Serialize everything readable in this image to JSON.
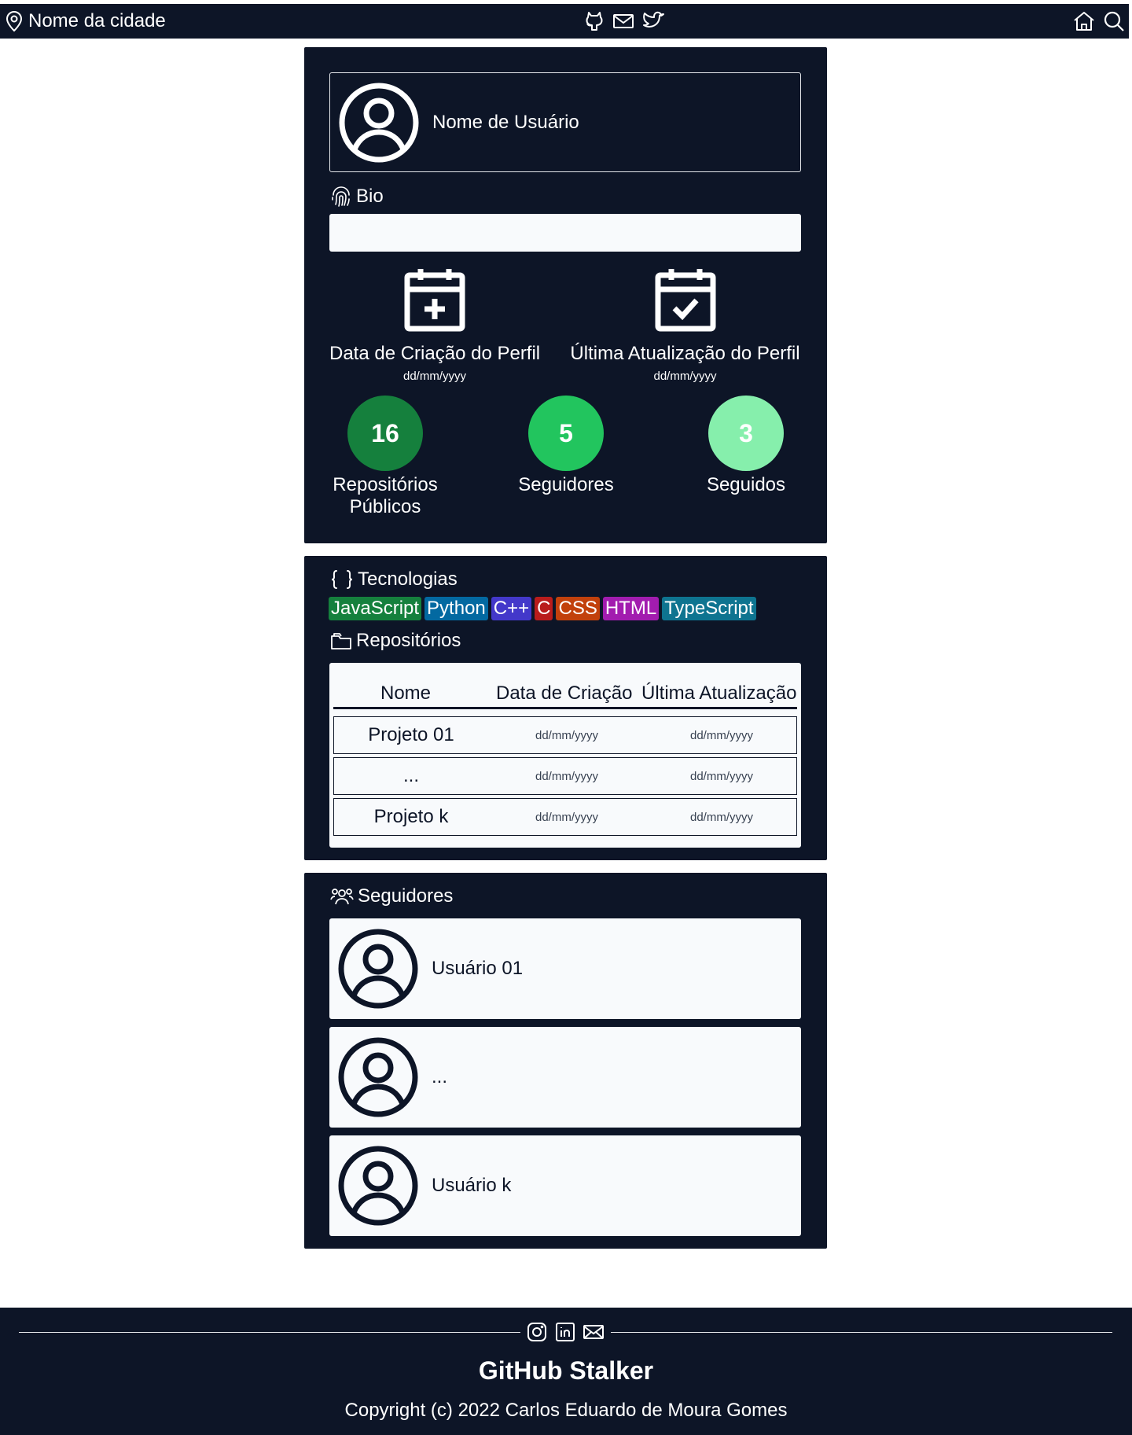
{
  "navbar": {
    "city": "Nome da cidade",
    "icons": [
      "location-icon",
      "github-icon",
      "mail-icon",
      "twitter-icon",
      "home-icon",
      "search-icon"
    ]
  },
  "profile": {
    "username": "Nome de Usuário",
    "bio_label": "Bio",
    "bio_value": "",
    "created_label": "Data de Criação do Perfil",
    "created_value": "dd/mm/yyyy",
    "updated_label": "Última Atualização do Perfil",
    "updated_value": "dd/mm/yyyy",
    "stats": [
      {
        "value": "16",
        "label": "Repositórios Públicos",
        "color": "#15803d"
      },
      {
        "value": "5",
        "label": "Seguidores",
        "color": "#22c55e"
      },
      {
        "value": "3",
        "label": "Seguidos",
        "color": "#86efac"
      }
    ]
  },
  "technologies": {
    "title": "Tecnologias",
    "items": [
      {
        "label": "JavaScript",
        "color": "#15803d"
      },
      {
        "label": "Python",
        "color": "#0369a1"
      },
      {
        "label": "C++",
        "color": "#4338ca"
      },
      {
        "label": "C",
        "color": "#b91c1c"
      },
      {
        "label": "CSS",
        "color": "#c2410c"
      },
      {
        "label": "HTML",
        "color": "#a21caf"
      },
      {
        "label": "TypeScript",
        "color": "#0e7490"
      }
    ]
  },
  "repositories": {
    "title": "Repositórios",
    "columns": [
      "Nome",
      "Data de Criação",
      "Última Atualização"
    ],
    "rows": [
      {
        "name": "Projeto 01",
        "created": "dd/mm/yyyy",
        "updated": "dd/mm/yyyy"
      },
      {
        "name": "...",
        "created": "dd/mm/yyyy",
        "updated": "dd/mm/yyyy"
      },
      {
        "name": "Projeto k",
        "created": "dd/mm/yyyy",
        "updated": "dd/mm/yyyy"
      }
    ]
  },
  "followers": {
    "title": "Seguidores",
    "items": [
      "Usuário 01",
      "...",
      "Usuário k"
    ]
  },
  "footer": {
    "icons": [
      "instagram-icon",
      "linkedin-icon",
      "mail-icon"
    ],
    "title": "GitHub Stalker",
    "copyright": "Copyright (c) 2022 Carlos Eduardo de Moura Gomes"
  },
  "colors": {
    "dark": "#0d1527",
    "light": "#f8fafc"
  }
}
